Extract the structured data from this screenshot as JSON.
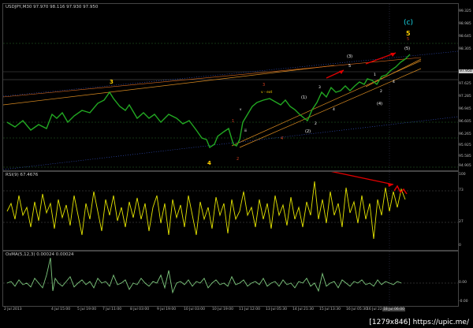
{
  "main": {
    "label": "USDJPY,M30  97.970 98.116 97.930 97.950",
    "y_ticks": [
      "99.325",
      "98.985",
      "98.645",
      "98.305",
      "97.950",
      "97.625",
      "97.285",
      "96.945",
      "96.605",
      "96.265",
      "95.925",
      "95.585",
      "95.245",
      "94.905"
    ],
    "waves": {
      "w_c": "(c)",
      "w_5_yellow": "5",
      "w_3": "3",
      "w_4": "4",
      "w_big3": "(3)",
      "w_5a": "5",
      "w_1p": "(1)",
      "w_2p": "(2)",
      "w_4p": "(4)",
      "w_ext": "v - ext",
      "w_1r": "1",
      "w_2r": "2",
      "w_3r": "3",
      "w_4r": "4",
      "w_5r": "5",
      "w_rr5": "(5)",
      "w_iii": "iii",
      "w_v": "v",
      "w_2b": "2",
      "w_4b": "4",
      "w_1w": "1",
      "w_2w": "2",
      "w_3w": "3",
      "w_4w": "4"
    }
  },
  "rsi": {
    "label": "RSI(9) 67.4676",
    "y_ticks": [
      "100",
      "73",
      "27",
      "0"
    ]
  },
  "osma": {
    "label": "OsMA(5,12,3) 0.00024 0.00024",
    "y_ticks": [
      "0.00",
      "-0.00"
    ]
  },
  "time_axis": [
    "2 Jul 2013",
    "4 Jul 15:00",
    "5 Jul 19:00",
    "7 Jul 11:00",
    "8 Jul 03:00",
    "9 Jul 19:00",
    "10 Jul 03:00",
    "10 Jul 19:00",
    "11 Jul 12:00",
    "12 Jul 03:00",
    "13 Jul 05:30",
    "14 Jul 21:30",
    "15 Jul 13:30",
    "16 Jul 05:30",
    "16 Jul 22:00"
  ],
  "time_highlight": "18 Jul 06:00",
  "watermark": "[1279x846] https://upic.me/",
  "colors": {
    "price": "#22a822",
    "rsi": "#e6e600",
    "osma": "#7ec87e",
    "channel_orange": "#d88a20",
    "channel_blue": "#3a5ad8",
    "arrow": "#e00000"
  }
}
